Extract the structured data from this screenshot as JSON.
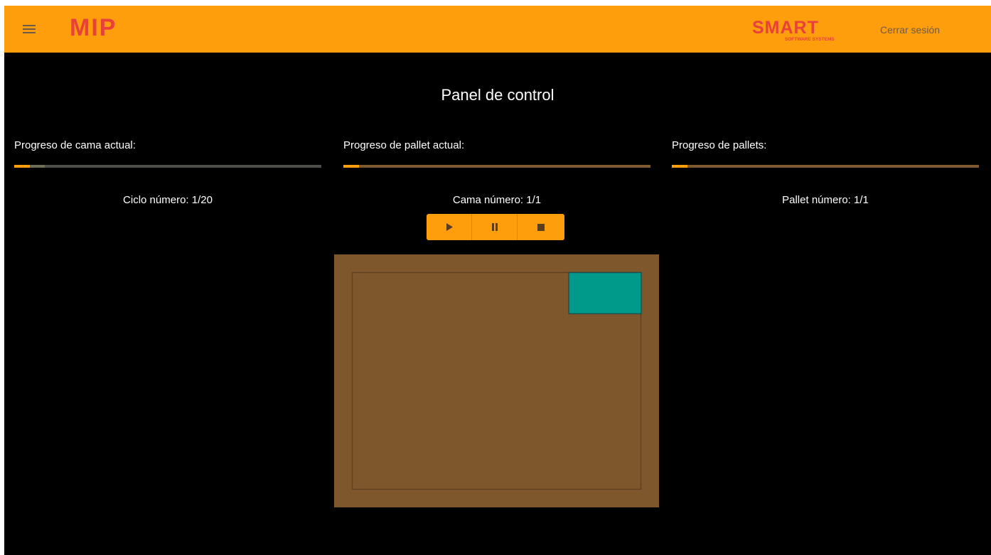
{
  "header": {
    "brand_mip": "MIP",
    "brand_smart_main": "SMART",
    "brand_smart_sub": "SOFTWARE SYSTEMS",
    "logout_label": "Cerrar sesión",
    "icons": {
      "menu": "menu-icon"
    },
    "colors": {
      "bar": "#ff9e0d",
      "brand_red": "#e8413a",
      "brand_gray": "#b9a8a0"
    }
  },
  "main": {
    "title": "Panel de control",
    "progress": [
      {
        "label": "Progreso de cama actual:",
        "count_text": "Ciclo número: 1/20",
        "fill_fraction": 0.05,
        "buffer_fraction": 0.1
      },
      {
        "label": "Progreso de pallet actual:",
        "count_text": "Cama número: 1/1",
        "fill_fraction": 0.05,
        "buffer_fraction": 1.0
      },
      {
        "label": "Progreso de pallets:",
        "count_text": "Pallet número: 1/1",
        "fill_fraction": 0.05,
        "buffer_fraction": 1.0
      }
    ],
    "controls": [
      {
        "name": "play-button",
        "icon": "play-icon"
      },
      {
        "name": "pause-button",
        "icon": "pause-icon"
      },
      {
        "name": "stop-button",
        "icon": "stop-icon"
      }
    ],
    "colors": {
      "accent": "#ff9e0d",
      "progress_track": "#6d6d58",
      "progress_track_full": "#7f5a2e",
      "pallet": "#7f572c",
      "box": "#009a8a"
    }
  }
}
